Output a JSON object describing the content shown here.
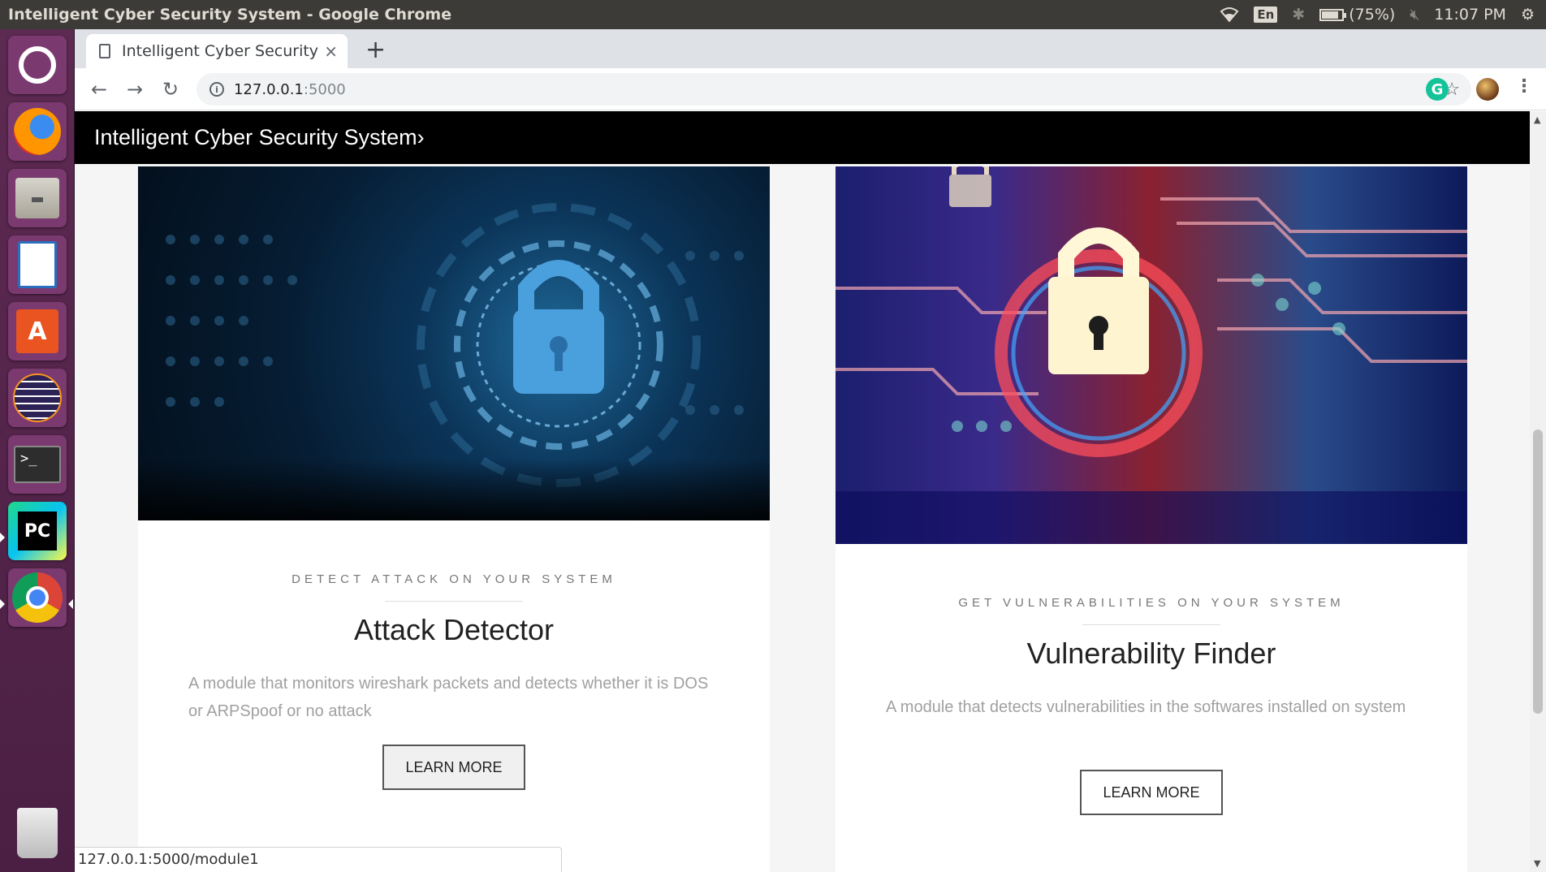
{
  "os": {
    "window_title": "Intelligent Cyber Security System - Google Chrome",
    "tray": {
      "keyboard_lang": "En",
      "battery_text": "(75%)",
      "battery_level": 0.75,
      "clock": "11:07 PM"
    },
    "launcher": [
      "ubuntu-dash",
      "firefox",
      "files",
      "libreoffice-writer",
      "software-center",
      "eclipse",
      "terminal",
      "pycharm",
      "chrome",
      "trash"
    ]
  },
  "browser": {
    "tab": {
      "label": "Intelligent Cyber Security",
      "close": "×"
    },
    "new_tab": "+",
    "nav": {
      "back": "←",
      "forward": "→",
      "reload": "↻"
    },
    "omnibox": {
      "host": "127.0.0.1",
      "port": ":5000",
      "info": "i",
      "star": "☆"
    },
    "extension_label": "G",
    "menu": "⋮",
    "status_url": "127.0.0.1:5000/module1"
  },
  "page": {
    "brand": "Intelligent Cyber Security System›",
    "cards": [
      {
        "subtitle": "DETECT ATTACK ON YOUR SYSTEM",
        "title": "Attack Detector",
        "description": "A module that monitors wireshark packets and detects whether it is DOS or ARPSpoof or no attack",
        "button": "LEARN MORE"
      },
      {
        "subtitle": "GET VULNERABILITIES ON YOUR SYSTEM",
        "title": "Vulnerability Finder",
        "description": "A module that detects vulnerabilities in the softwares installed on system",
        "button": "LEARN MORE"
      }
    ]
  },
  "colors": {
    "header_bg": "#000000",
    "launcher_bg": "#5d2a52",
    "panel_bg": "#3c3b37"
  }
}
